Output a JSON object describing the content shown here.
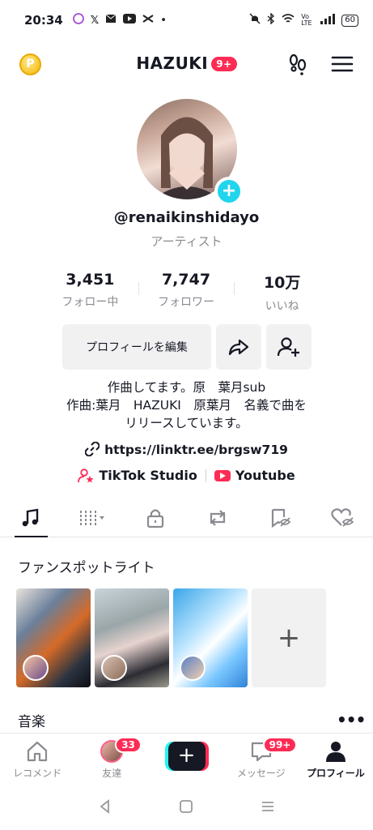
{
  "status_bar": {
    "time": "20:34",
    "battery": "60",
    "network": "Vo LTE"
  },
  "header": {
    "title": "HAZUKI",
    "badge": "9+"
  },
  "profile": {
    "username": "@renaikinshidayo",
    "category": "アーティスト",
    "stats": [
      {
        "value": "3,451",
        "label": "フォロー中"
      },
      {
        "value": "7,747",
        "label": "フォロワー"
      },
      {
        "value": "10万",
        "label": "いいね"
      }
    ],
    "edit_button": "プロフィールを編集",
    "bio_lines": [
      "作曲してます。原　葉月sub",
      "作曲:葉月　HAZUKI　原葉月　名義で曲を",
      "リリースしています。"
    ],
    "link": "https://linktr.ee/brgsw719",
    "extras": [
      "TikTok Studio",
      "Youtube"
    ]
  },
  "tabs": [
    "music-icon",
    "bars-dropdown-icon",
    "lock-icon",
    "repost-icon",
    "bookmark-eye-icon",
    "heart-eye-icon"
  ],
  "sections": {
    "spotlight_title": "ファンスポットライト",
    "add_symbol": "+",
    "music_title": "音楽"
  },
  "bottom_nav": {
    "items": [
      {
        "label": "レコメンド"
      },
      {
        "label": "友達",
        "badge": "33"
      },
      {
        "label": ""
      },
      {
        "label": "メッセージ",
        "badge": "99+"
      },
      {
        "label": "プロフィール"
      }
    ]
  },
  "colors": {
    "accent": "#fe2c55",
    "cyan": "#20d5ec",
    "text": "#161823",
    "muted": "#8a8b91"
  }
}
